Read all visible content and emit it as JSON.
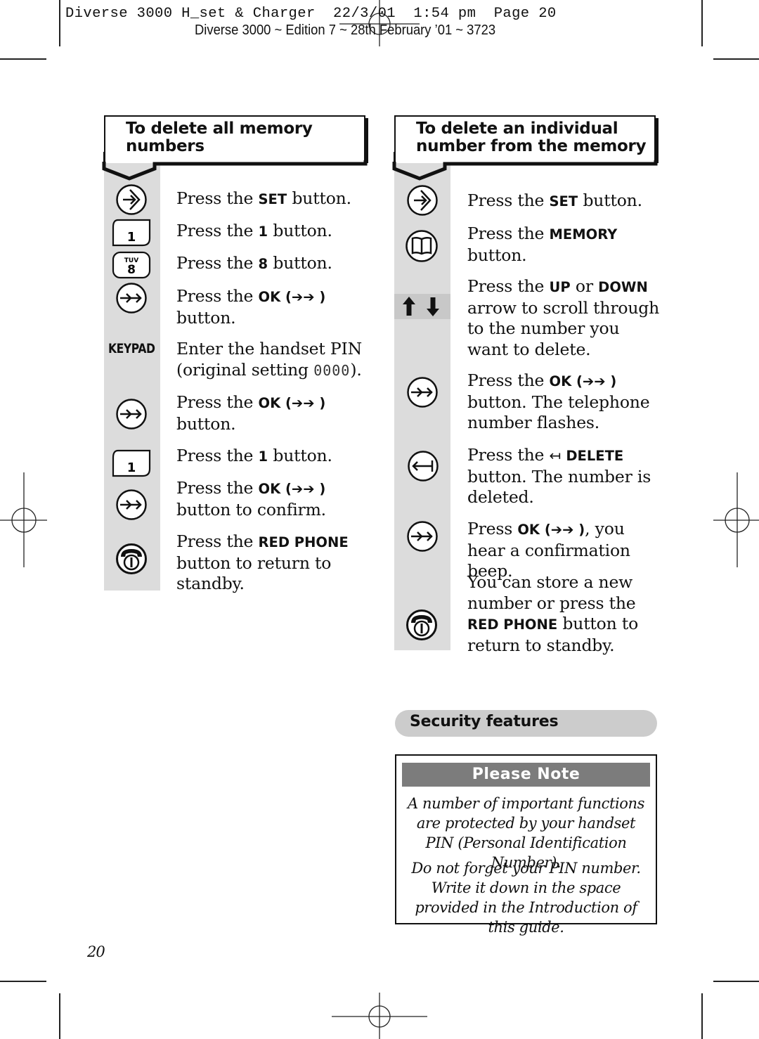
{
  "slug": {
    "line1": "Diverse 3000 H_set & Charger  22/3/01  1:54 pm  Page 20",
    "line2": "Diverse 3000 ~ Edition 7 ~ 28th February ’01 ~ 3723"
  },
  "left_section": {
    "title_line1": "To delete all memory",
    "title_line2": "numbers",
    "steps": [
      {
        "icon": "set-icon",
        "pre": "Press the ",
        "bold": "SET",
        "post": " button."
      },
      {
        "icon": "key-1-icon",
        "key_label": "1",
        "pre": "Press the ",
        "bold": "1",
        "post": " button."
      },
      {
        "icon": "key-8-icon",
        "key_label": "8",
        "key_sub": "TUV",
        "pre": "Press the ",
        "bold": "8",
        "post": " button."
      },
      {
        "icon": "ok-icon",
        "pre": "Press the ",
        "bold": "OK (➔➔ )",
        "post": " button."
      },
      {
        "icon": "keypad-label",
        "icon_label": "KEYPAD",
        "line1": "Enter the handset PIN",
        "line2_pre": "(original setting ",
        "pin": "0000",
        "line2_post": ")."
      },
      {
        "icon": "ok-icon",
        "pre": "Press the ",
        "bold": "OK (➔➔ )",
        "post": " button."
      },
      {
        "icon": "key-1-icon",
        "key_label": "1",
        "pre": "Press the ",
        "bold": "1",
        "post": " button."
      },
      {
        "icon": "ok-icon",
        "pre": "Press the ",
        "bold": "OK (➔➔ )",
        "post": " button to confirm."
      },
      {
        "icon": "red-phone-icon",
        "pre": "Press the ",
        "bold": "RED PHONE",
        "post": " button to return to standby."
      }
    ]
  },
  "right_section": {
    "title_line1": "To delete an individual",
    "title_line2": "number from the memory",
    "steps": [
      {
        "icon": "set-icon",
        "pre": "Press the ",
        "bold": "SET",
        "post": " button."
      },
      {
        "icon": "memory-book-icon",
        "pre": "Press the ",
        "bold": "MEMORY",
        "post": " button."
      },
      {
        "icon": "up-down-arrows-icon",
        "pre": "Press the ",
        "bold": "UP",
        "mid": " or ",
        "bold2": "DOWN",
        "post": " arrow to scroll through to the number you want to delete."
      },
      {
        "icon": "ok-icon",
        "pre": "Press the ",
        "bold": "OK (➔➔ )",
        "post": " button. The telephone number flashes."
      },
      {
        "icon": "delete-icon",
        "pre": "Press the ",
        "glyph": "↤",
        "bold": "DELETE",
        "post": " button. The number is deleted."
      },
      {
        "icon": "ok-icon",
        "pre": "Press ",
        "bold": "OK (➔➔ )",
        "post": ", you hear a confirmation beep."
      },
      {
        "icon": "red-phone-icon",
        "pre": "You can store a new number or press the ",
        "bold": "RED PHONE",
        "post": " button to return to standby."
      }
    ]
  },
  "security": {
    "title": "Security features"
  },
  "note": {
    "heading": "Please Note",
    "para1": "A number of important functions are protected by your handset PIN (Personal Identification Number).",
    "para2": "Do not forget your PIN number. Write it down in the space provided in the Introduction of this guide."
  },
  "page_number": "20"
}
